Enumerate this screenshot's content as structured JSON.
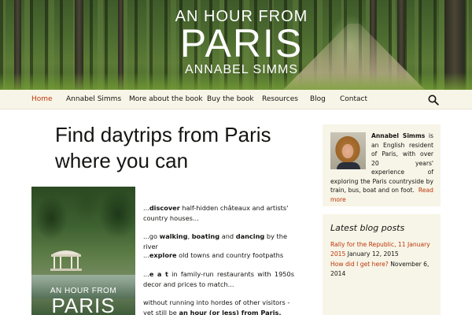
{
  "header": {
    "title_line1": "AN HOUR FROM",
    "title_line2": "PARIS",
    "title_line3": "ANNABEL SIMMS"
  },
  "nav": {
    "items": [
      {
        "label": "Home",
        "active": true
      },
      {
        "label": "Annabel Simms",
        "active": false
      },
      {
        "label": "More about the book",
        "active": false
      },
      {
        "label": "Buy the book",
        "active": false
      },
      {
        "label": "Resources",
        "active": false
      },
      {
        "label": "Blog",
        "active": false
      },
      {
        "label": "Contact",
        "active": false
      }
    ],
    "search_icon": "search-icon"
  },
  "main": {
    "title": "Find daytrips from Paris where you can",
    "book_cover": {
      "line1": "AN HOUR FROM",
      "line2": "PARIS"
    },
    "intro": [
      {
        "prefix": "...",
        "bold": "discover",
        "rest": " half-hidden châteaux and artists' country houses..."
      },
      {
        "prefix": "...go ",
        "bold": "walking",
        "mid1": ", ",
        "bold2": "boating",
        "mid2": " and ",
        "bold3": "dancing",
        "rest": " by the river"
      },
      {
        "prefix": "...",
        "bold": "explore",
        "rest": " old towns and country footpaths"
      },
      {
        "prefix": "...",
        "bold": "e a t",
        "rest": " in family-run restaurants with 1950s decor and prices to match..."
      },
      {
        "prefix": "without running into hordes of other visitors - yet still be ",
        "bold": "an hour (or less) from Paris.",
        "rest": ""
      }
    ]
  },
  "sidebar": {
    "author": {
      "name": "Annabel Simms",
      "bio": " is an English resident of Paris, with over 20 years' experience of exploring the Paris countryside by train, bus, boat and on foot.",
      "read_more": "Read more"
    },
    "latest_posts": {
      "title": "Latest blog posts",
      "posts": [
        {
          "link": "Rally for the Republic, 11 January 2015",
          "date": "January 12, 2015"
        },
        {
          "link": "How did I get here?",
          "date": "November 6, 2014"
        }
      ]
    }
  }
}
